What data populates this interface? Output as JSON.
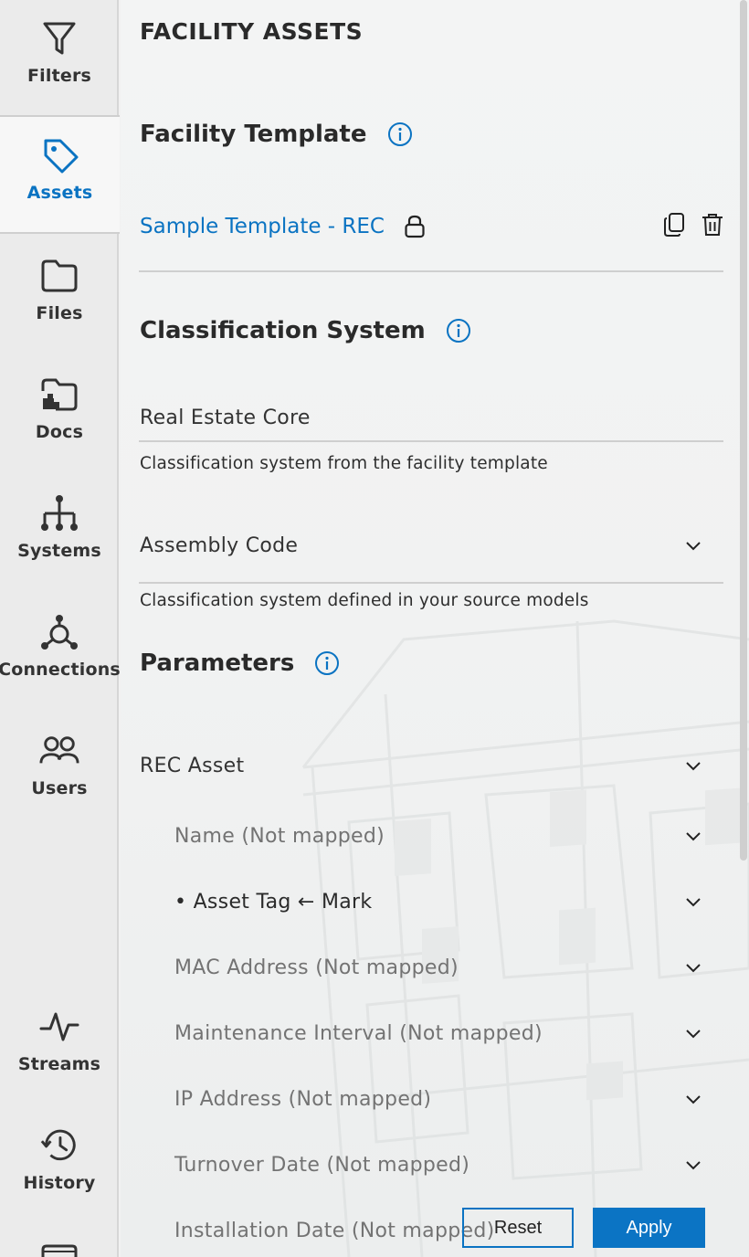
{
  "nav": {
    "items": [
      {
        "label": "Filters",
        "icon": "filter-icon"
      },
      {
        "label": "Assets",
        "icon": "tag-icon",
        "active": true
      },
      {
        "label": "Files",
        "icon": "folder-icon"
      },
      {
        "label": "Docs",
        "icon": "docs-folder-icon"
      },
      {
        "label": "Systems",
        "icon": "hierarchy-icon"
      },
      {
        "label": "Connections",
        "icon": "connections-icon"
      },
      {
        "label": "Users",
        "icon": "users-icon"
      },
      {
        "label": "Streams",
        "icon": "pulse-icon"
      },
      {
        "label": "History",
        "icon": "history-icon"
      }
    ]
  },
  "panel": {
    "title": "FACILITY ASSETS",
    "facility_template": {
      "heading": "Facility Template",
      "template_name": "Sample Template - REC"
    },
    "classification": {
      "heading": "Classification System",
      "template_system": "Real Estate Core",
      "template_help": "Classification system from the facility template",
      "model_system": "Assembly Code",
      "model_help": "Classification system defined in your source models"
    },
    "parameters": {
      "heading": "Parameters",
      "group": "REC Asset",
      "items": [
        {
          "label": "Name (Not mapped)",
          "mapped": false
        },
        {
          "label": "• Asset Tag ← Mark",
          "mapped": true
        },
        {
          "label": "MAC Address (Not mapped)",
          "mapped": false
        },
        {
          "label": "Maintenance Interval (Not mapped)",
          "mapped": false
        },
        {
          "label": "IP Address (Not mapped)",
          "mapped": false
        },
        {
          "label": "Turnover Date (Not mapped)",
          "mapped": false
        },
        {
          "label": "Installation Date (Not mapped)",
          "mapped": false
        }
      ]
    },
    "actions": {
      "reset": "Reset",
      "apply": "Apply"
    }
  },
  "colors": {
    "accent": "#0a73c2",
    "rail_bg": "#ebebeb",
    "panel_bg": "#f1f2f2",
    "muted_text": "#737373"
  }
}
